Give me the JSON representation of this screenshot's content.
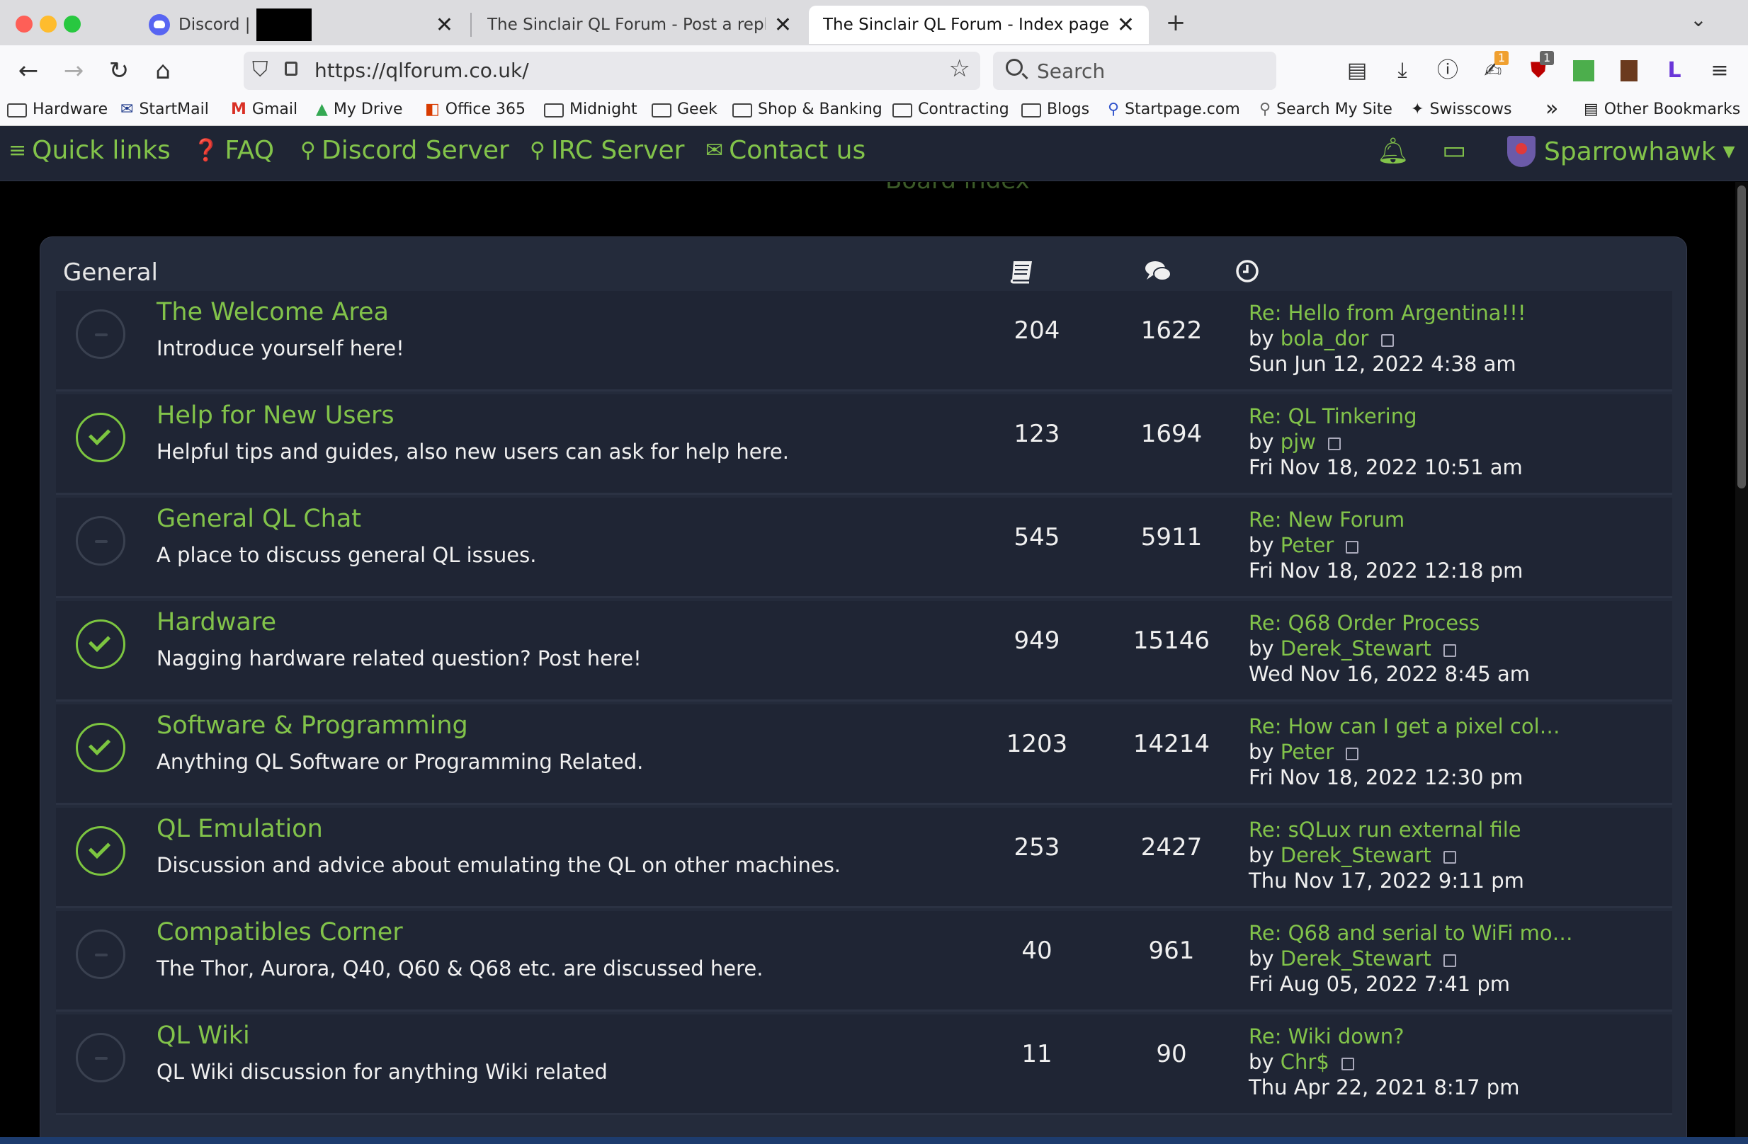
{
  "browser": {
    "tabs": [
      {
        "title": "Discord |",
        "active": false
      },
      {
        "title": "The Sinclair QL Forum - Post a reply",
        "active": false
      },
      {
        "title": "The Sinclair QL Forum - Index page",
        "active": true
      }
    ],
    "url": "https://qlforum.co.uk/",
    "search_placeholder": "Search",
    "extension_badges": [
      "1",
      "1"
    ],
    "extension_letter": "L",
    "bookmarks": [
      "Hardware",
      "StartMail",
      "Gmail",
      "My Drive",
      "Office 365",
      "Midnight",
      "Geek",
      "Shop & Banking",
      "Contracting",
      "Blogs",
      "Startpage.com",
      "Search My Site",
      "Swisscows"
    ],
    "other_bookmarks": "Other Bookmarks",
    "more_bookmarks": "»"
  },
  "forum_nav": {
    "quick_links": "Quick links",
    "faq": "FAQ",
    "discord": "Discord Server",
    "irc": "IRC Server",
    "contact": "Contact us",
    "user": "Sparrowhawk",
    "breadcrumb": "Board index"
  },
  "category": {
    "title": "General",
    "column_icons": [
      "topics-icon",
      "posts-icon",
      "last-post-icon"
    ]
  },
  "forums": [
    {
      "name": "The Welcome Area",
      "desc": "Introduce yourself here!",
      "topics": "204",
      "posts": "1622",
      "last_title": "Re: Hello from Argentina!!!",
      "last_author": "bola_dor",
      "last_time": "Sun Jun 12, 2022 4:38 am",
      "unread": false
    },
    {
      "name": "Help for New Users",
      "desc": "Helpful tips and guides, also new users can ask for help here.",
      "topics": "123",
      "posts": "1694",
      "last_title": "Re: QL Tinkering",
      "last_author": "pjw",
      "last_time": "Fri Nov 18, 2022 10:51 am",
      "unread": true
    },
    {
      "name": "General QL Chat",
      "desc": "A place to discuss general QL issues.",
      "topics": "545",
      "posts": "5911",
      "last_title": "Re: New Forum",
      "last_author": "Peter",
      "last_time": "Fri Nov 18, 2022 12:18 pm",
      "unread": false
    },
    {
      "name": "Hardware",
      "desc": "Nagging hardware related question? Post here!",
      "topics": "949",
      "posts": "15146",
      "last_title": "Re: Q68 Order Process",
      "last_author": "Derek_Stewart",
      "last_time": "Wed Nov 16, 2022 8:45 am",
      "unread": true
    },
    {
      "name": "Software & Programming",
      "desc": "Anything QL Software or Programming Related.",
      "topics": "1203",
      "posts": "14214",
      "last_title": "Re: How can I get a pixel col…",
      "last_author": "Peter",
      "last_time": "Fri Nov 18, 2022 12:30 pm",
      "unread": true
    },
    {
      "name": "QL Emulation",
      "desc": "Discussion and advice about emulating the QL on other machines.",
      "topics": "253",
      "posts": "2427",
      "last_title": "Re: sQLux run external file",
      "last_author": "Derek_Stewart",
      "last_time": "Thu Nov 17, 2022 9:11 pm",
      "unread": true
    },
    {
      "name": "Compatibles Corner",
      "desc": "The Thor, Aurora, Q40, Q60 & Q68 etc. are discussed here.",
      "topics": "40",
      "posts": "961",
      "last_title": "Re: Q68 and serial to WiFi mo…",
      "last_author": "Derek_Stewart",
      "last_time": "Fri Aug 05, 2022 7:41 pm",
      "unread": false
    },
    {
      "name": "QL Wiki",
      "desc": "QL Wiki discussion for anything Wiki related",
      "topics": "11",
      "posts": "90",
      "last_title": "Re: Wiki down?",
      "last_author": "Chr$",
      "last_time": "Thu Apr 22, 2021 8:17 pm",
      "unread": false
    }
  ],
  "labels": {
    "by": "by"
  },
  "colors": {
    "accent": "#82c34a",
    "panel": "#242b3b",
    "row": "#1f2534",
    "text": "#f0f0f0"
  }
}
